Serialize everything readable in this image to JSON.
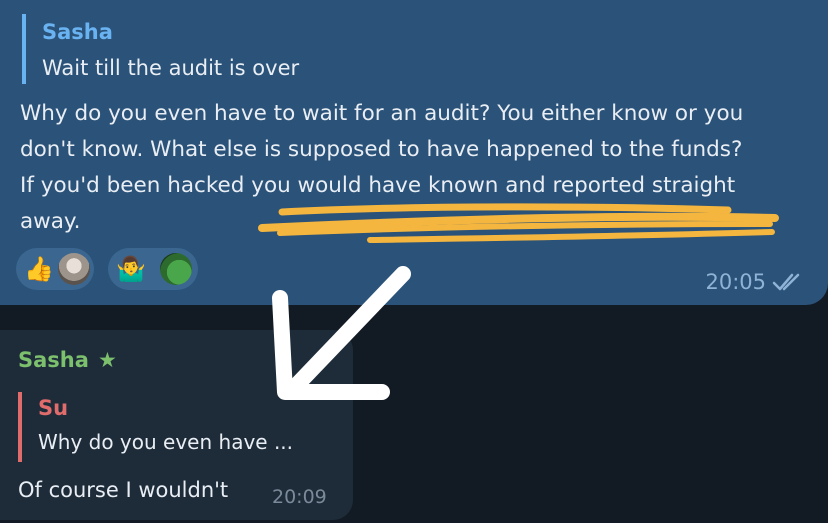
{
  "outgoing": {
    "quote_author": "Sasha",
    "quote_text": "Wait till the audit is over",
    "line1": "Why do you even have to wait for an audit? You either know or you",
    "line2": "don't know. What else is supposed to have happened to the funds?",
    "line3": "If you'd been hacked you would have known and reported straight",
    "line4": "away.",
    "reactions": [
      "👍",
      "🤷‍♂️"
    ],
    "time": "20:05",
    "status_icon": "double-check-icon"
  },
  "incoming": {
    "author": "Sasha",
    "quote_author": "Su",
    "quote_text": "Why do you even have ...",
    "text": "Of course I wouldn't",
    "time": "20:09"
  },
  "colors": {
    "outgoing_bubble": "#2b5278",
    "incoming_bubble": "#1e2c3a",
    "highlight": "#f4b63f",
    "arrow": "#ffffff"
  }
}
